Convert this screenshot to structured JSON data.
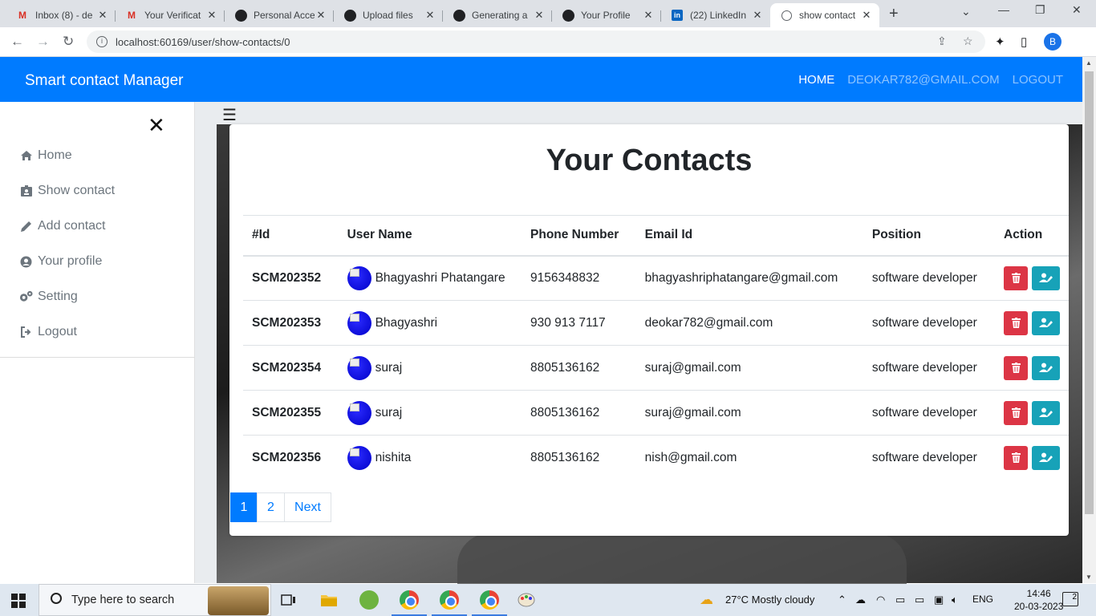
{
  "browser": {
    "tabs": [
      {
        "title": "Inbox (8) - de",
        "icon": "gmail"
      },
      {
        "title": "Your Verificat",
        "icon": "gmail"
      },
      {
        "title": "Personal Acce",
        "icon": "github"
      },
      {
        "title": "Upload files",
        "icon": "github"
      },
      {
        "title": "Generating a",
        "icon": "github"
      },
      {
        "title": "Your Profile",
        "icon": "github"
      },
      {
        "title": "(22) LinkedIn",
        "icon": "linkedin"
      },
      {
        "title": "show contact",
        "icon": "globe",
        "active": true
      }
    ],
    "url": "localhost:60169/user/show-contacts/0",
    "profile_initial": "B"
  },
  "navbar": {
    "brand": "Smart contact Manager",
    "links": [
      "HOME",
      "DEOKAR782@GMAIL.COM",
      "LOGOUT"
    ]
  },
  "sidebar": {
    "close": "✕",
    "items": [
      {
        "label": "Home",
        "icon": "home-icon"
      },
      {
        "label": "Show contact",
        "icon": "id-card-icon"
      },
      {
        "label": "Add contact",
        "icon": "pencil-icon"
      },
      {
        "label": "Your profile",
        "icon": "user-circle-icon"
      },
      {
        "label": "Setting",
        "icon": "gears-icon"
      },
      {
        "label": "Logout",
        "icon": "sign-out-icon"
      }
    ]
  },
  "main": {
    "title": "Your Contacts",
    "columns": [
      "#Id",
      "User Name",
      "Phone Number",
      "Email Id",
      "Position",
      "Action"
    ],
    "rows": [
      {
        "id": "SCM202352",
        "name": "Bhagyashri Phatangare",
        "phone": "9156348832",
        "email": "bhagyashriphatangare@gmail.com",
        "position": "software developer"
      },
      {
        "id": "SCM202353",
        "name": "Bhagyashri",
        "phone": "930 913 7117",
        "email": "deokar782@gmail.com",
        "position": "software developer"
      },
      {
        "id": "SCM202354",
        "name": "suraj",
        "phone": "8805136162",
        "email": "suraj@gmail.com",
        "position": "software developer"
      },
      {
        "id": "SCM202355",
        "name": "suraj",
        "phone": "8805136162",
        "email": "suraj@gmail.com",
        "position": "software developer"
      },
      {
        "id": "SCM202356",
        "name": "nishita",
        "phone": "8805136162",
        "email": "nish@gmail.com",
        "position": "software developer"
      }
    ],
    "pagination": [
      "1",
      "2",
      "Next"
    ]
  },
  "taskbar": {
    "search_placeholder": "Type here to search",
    "weather": "27°C  Mostly cloudy",
    "language": "ENG",
    "time": "14:46",
    "date": "20-03-2023",
    "notifications": "2"
  },
  "colors": {
    "primary": "#007bff",
    "danger": "#dc3545",
    "info": "#17a2b8"
  }
}
